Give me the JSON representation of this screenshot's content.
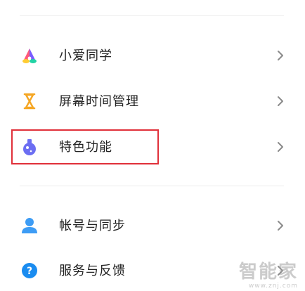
{
  "settings_list": {
    "items": [
      {
        "label": "小爱同学",
        "icon": "xiaoai-logo-icon"
      },
      {
        "label": "屏幕时间管理",
        "icon": "hourglass-icon"
      },
      {
        "label": "特色功能",
        "icon": "flask-icon"
      },
      {
        "label": "帐号与同步",
        "icon": "person-icon"
      },
      {
        "label": "服务与反馈",
        "icon": "help-circle-icon"
      }
    ],
    "chevron_icon": "chevron-right-icon"
  },
  "highlight": {
    "target": "特色功能",
    "color": "#e0303a"
  },
  "watermark": {
    "mark": "智能家",
    "site": "www.znj.com"
  },
  "colors": {
    "hourglass": "#f5a623",
    "flask": "#6c6ef2",
    "person": "#3d9cf5",
    "help": "#1a8cf0",
    "chevron": "#8a8a8a"
  }
}
